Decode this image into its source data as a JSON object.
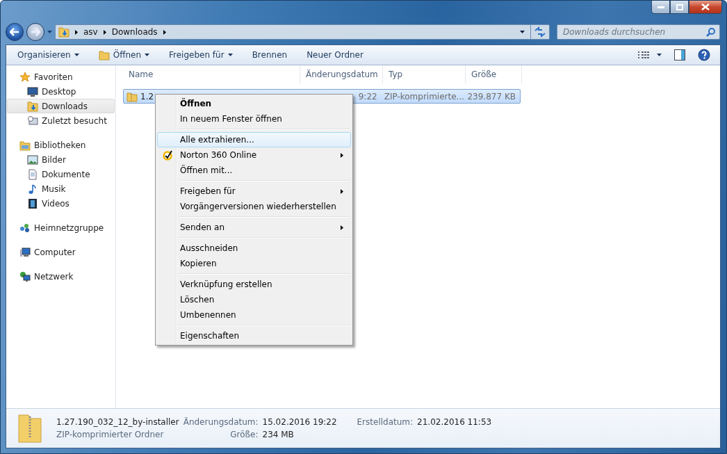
{
  "address": {
    "crumbs": [
      "asv",
      "Downloads"
    ]
  },
  "search": {
    "placeholder": "Downloads durchsuchen"
  },
  "toolbar": [
    {
      "label": "Organisieren",
      "dropdown": true,
      "icon": false
    },
    {
      "label": "Öffnen",
      "dropdown": true,
      "icon": true
    },
    {
      "label": "Freigeben für",
      "dropdown": true,
      "icon": false
    },
    {
      "label": "Brennen",
      "dropdown": false,
      "icon": false
    },
    {
      "label": "Neuer Ordner",
      "dropdown": false,
      "icon": false
    }
  ],
  "sidebar": [
    {
      "label": "Favoriten",
      "children": [
        {
          "label": "Desktop",
          "selected": false
        },
        {
          "label": "Downloads",
          "selected": true
        },
        {
          "label": "Zuletzt besucht",
          "selected": false
        }
      ]
    },
    {
      "label": "Bibliotheken",
      "children": [
        {
          "label": "Bilder",
          "selected": false
        },
        {
          "label": "Dokumente",
          "selected": false
        },
        {
          "label": "Musik",
          "selected": false
        },
        {
          "label": "Videos",
          "selected": false
        }
      ]
    },
    {
      "label": "Heimnetzgruppe"
    },
    {
      "label": "Computer"
    },
    {
      "label": "Netzwerk"
    }
  ],
  "table": {
    "columns": [
      "Name",
      "Änderungsdatum",
      "Typ",
      "Größe"
    ],
    "rows": [
      {
        "name": "1.2",
        "date": "9:22",
        "type": "ZIP-komprimierte...",
        "size": "239.877 KB",
        "selected": true
      }
    ]
  },
  "context_menu": [
    {
      "kind": "item",
      "label": "Öffnen",
      "bold": true,
      "submenu": false,
      "selected": false,
      "icon": false
    },
    {
      "kind": "item",
      "label": "In neuem Fenster öffnen",
      "bold": false,
      "submenu": false,
      "selected": false,
      "icon": false
    },
    {
      "kind": "separator"
    },
    {
      "kind": "item",
      "label": "Alle extrahieren...",
      "bold": false,
      "submenu": false,
      "selected": true,
      "icon": false
    },
    {
      "kind": "item",
      "label": "Norton 360 Online",
      "bold": false,
      "submenu": true,
      "selected": false,
      "icon": true
    },
    {
      "kind": "item",
      "label": "Öffnen mit...",
      "bold": false,
      "submenu": false,
      "selected": false,
      "icon": false
    },
    {
      "kind": "separator"
    },
    {
      "kind": "item",
      "label": "Freigeben für",
      "bold": false,
      "submenu": true,
      "selected": false,
      "icon": false
    },
    {
      "kind": "item",
      "label": "Vorgängerversionen wiederherstellen",
      "bold": false,
      "submenu": false,
      "selected": false,
      "icon": false
    },
    {
      "kind": "separator"
    },
    {
      "kind": "item",
      "label": "Senden an",
      "bold": false,
      "submenu": true,
      "selected": false,
      "icon": false
    },
    {
      "kind": "separator"
    },
    {
      "kind": "item",
      "label": "Ausschneiden",
      "bold": false,
      "submenu": false,
      "selected": false,
      "icon": false
    },
    {
      "kind": "item",
      "label": "Kopieren",
      "bold": false,
      "submenu": false,
      "selected": false,
      "icon": false
    },
    {
      "kind": "separator"
    },
    {
      "kind": "item",
      "label": "Verknüpfung erstellen",
      "bold": false,
      "submenu": false,
      "selected": false,
      "icon": false
    },
    {
      "kind": "item",
      "label": "Löschen",
      "bold": false,
      "submenu": false,
      "selected": false,
      "icon": false
    },
    {
      "kind": "item",
      "label": "Umbenennen",
      "bold": false,
      "submenu": false,
      "selected": false,
      "icon": false
    },
    {
      "kind": "separator"
    },
    {
      "kind": "item",
      "label": "Eigenschaften",
      "bold": false,
      "submenu": false,
      "selected": false,
      "icon": false
    }
  ],
  "details": {
    "name": "1.27.190_032_12_by-installer",
    "type": "ZIP-komprimierter Ordner",
    "fields": [
      {
        "label": "Änderungsdatum:",
        "value": "15.02.2016 19:22"
      },
      {
        "label": "Erstelldatum:",
        "value": "21.02.2016 11:53"
      },
      {
        "label": "Größe:",
        "value": "234 MB"
      }
    ]
  }
}
